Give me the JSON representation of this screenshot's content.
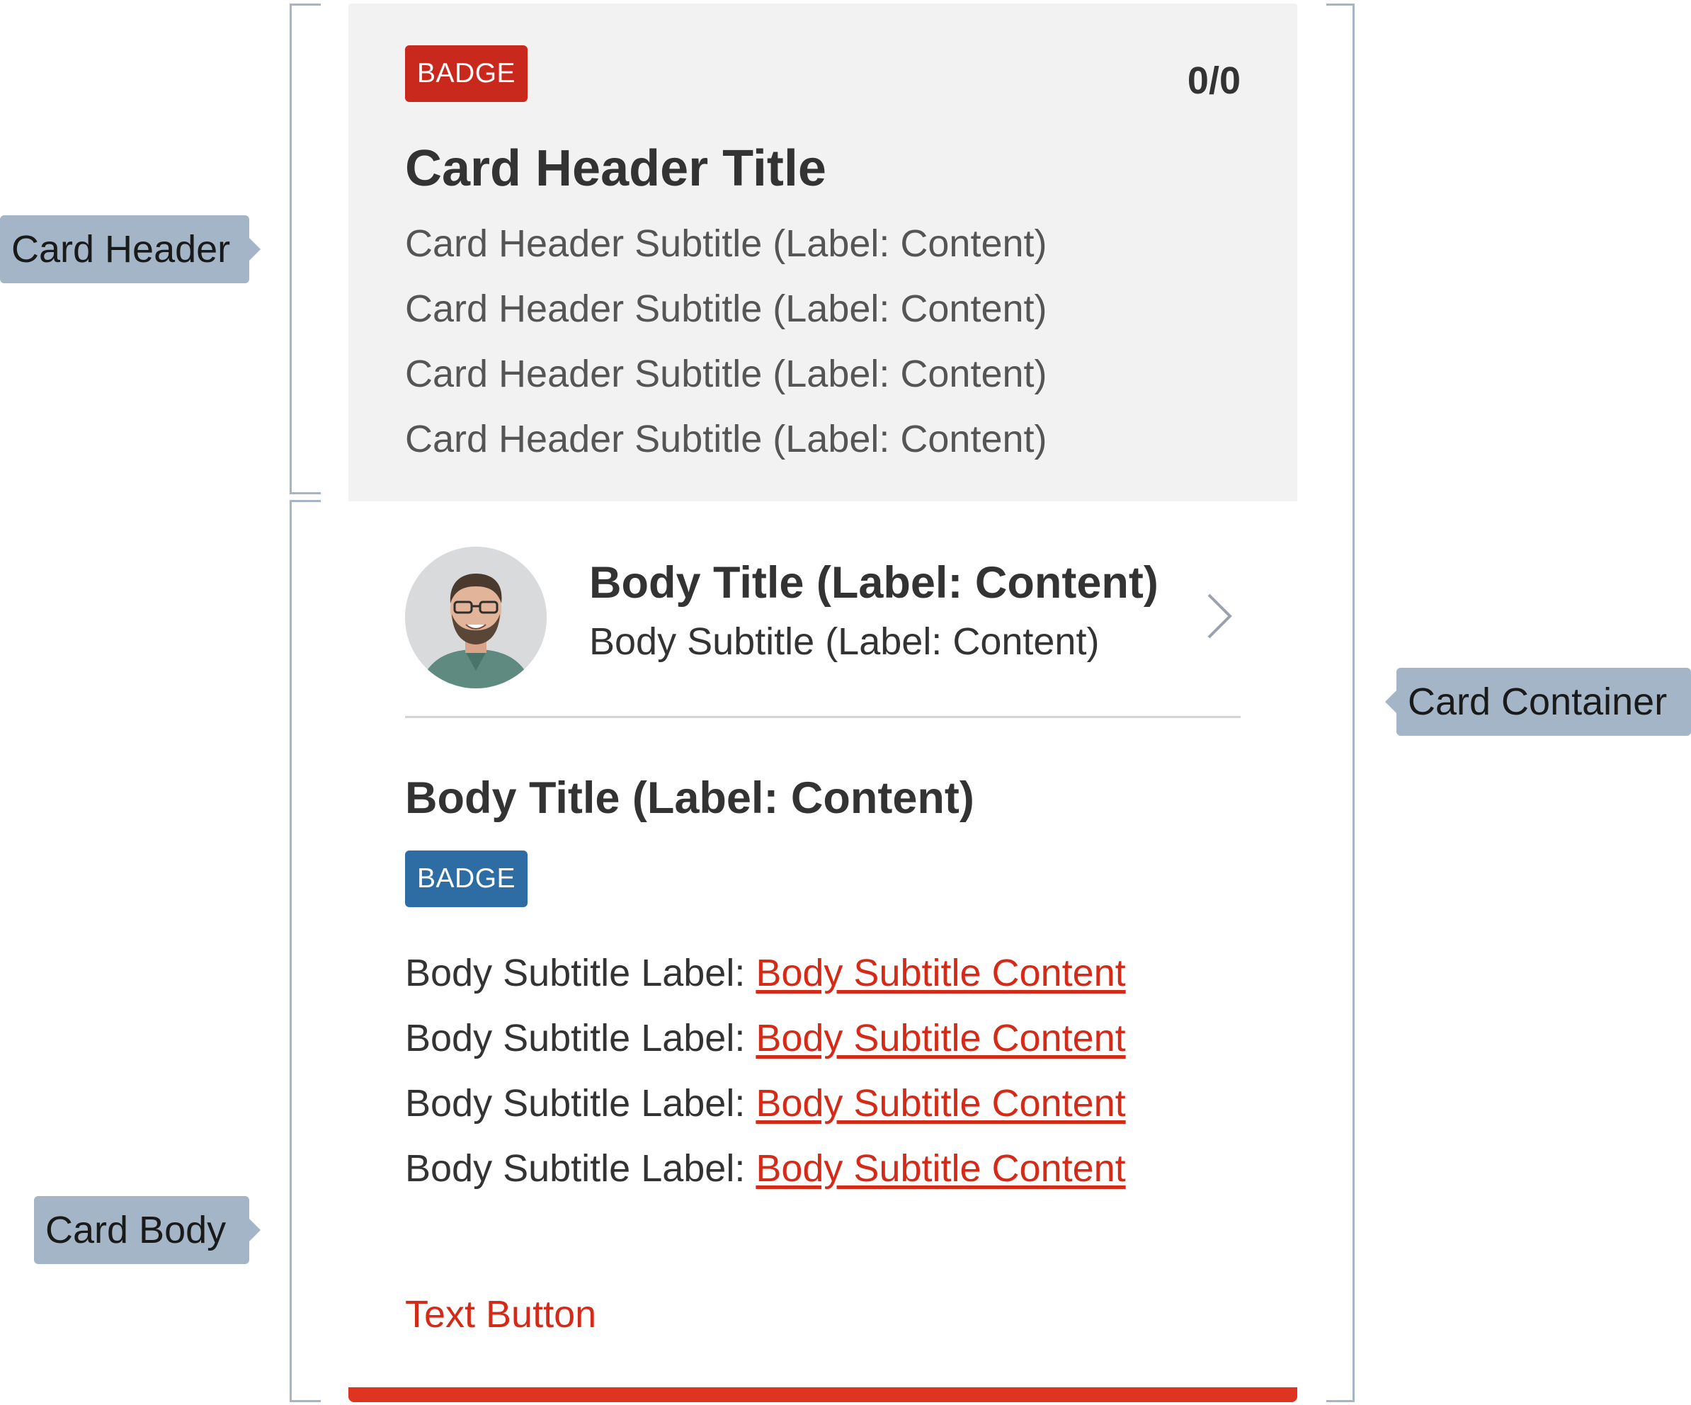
{
  "annotations": {
    "card_header": "Card Header",
    "card_body": "Card Body",
    "card_container": "Card Container"
  },
  "colors": {
    "annotation": "#a3b5c6",
    "header_background": "#f2f2f2",
    "badge_red": "#c9291d",
    "badge_blue": "#2e6da4",
    "link_red": "#d42a18",
    "bottom_bar": "#dd3522"
  },
  "card": {
    "header": {
      "badge": "BADGE",
      "counter": "0/0",
      "title": "Card Header Title",
      "subtitles": [
        "Card Header Subtitle (Label: Content)",
        "Card Header Subtitle (Label: Content)",
        "Card Header Subtitle (Label: Content)",
        "Card Header Subtitle (Label: Content)"
      ]
    },
    "body": {
      "person": {
        "avatar_icon": "person-avatar",
        "title": "Body Title (Label: Content)",
        "subtitle": "Body Subtitle (Label: Content)",
        "chevron_icon": "chevron-right-icon"
      },
      "title": "Body Title (Label: Content)",
      "badge": "BADGE",
      "details": [
        {
          "label": "Body Subtitle Label: ",
          "content": "Body Subtitle Content"
        },
        {
          "label": "Body Subtitle Label: ",
          "content": "Body Subtitle Content"
        },
        {
          "label": "Body Subtitle Label: ",
          "content": "Body Subtitle Content"
        },
        {
          "label": "Body Subtitle Label: ",
          "content": "Body Subtitle Content"
        }
      ],
      "text_button": "Text Button"
    }
  }
}
